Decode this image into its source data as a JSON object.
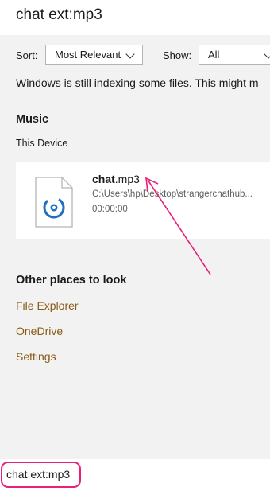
{
  "header": {
    "title": "chat ext:mp3"
  },
  "filters": {
    "sort_label": "Sort:",
    "sort_value": "Most Relevant",
    "show_label": "Show:",
    "show_value": "All"
  },
  "notice": "Windows is still indexing some files. This might m",
  "music": {
    "heading": "Music",
    "location": "This Device",
    "result": {
      "name_bold": "chat",
      "name_rest": ".mp3",
      "path": "C:\\Users\\hp\\Desktop\\strangerchathub...",
      "duration": "00:00:00",
      "icon": "music-file-icon"
    }
  },
  "other_places": {
    "heading": "Other places to look",
    "links": [
      "File Explorer",
      "OneDrive",
      "Settings"
    ]
  },
  "search": {
    "value": "chat ext:mp3"
  },
  "colors": {
    "link": "#8a5a14",
    "annotation": "#e8217a",
    "background": "#f2f2f2"
  }
}
